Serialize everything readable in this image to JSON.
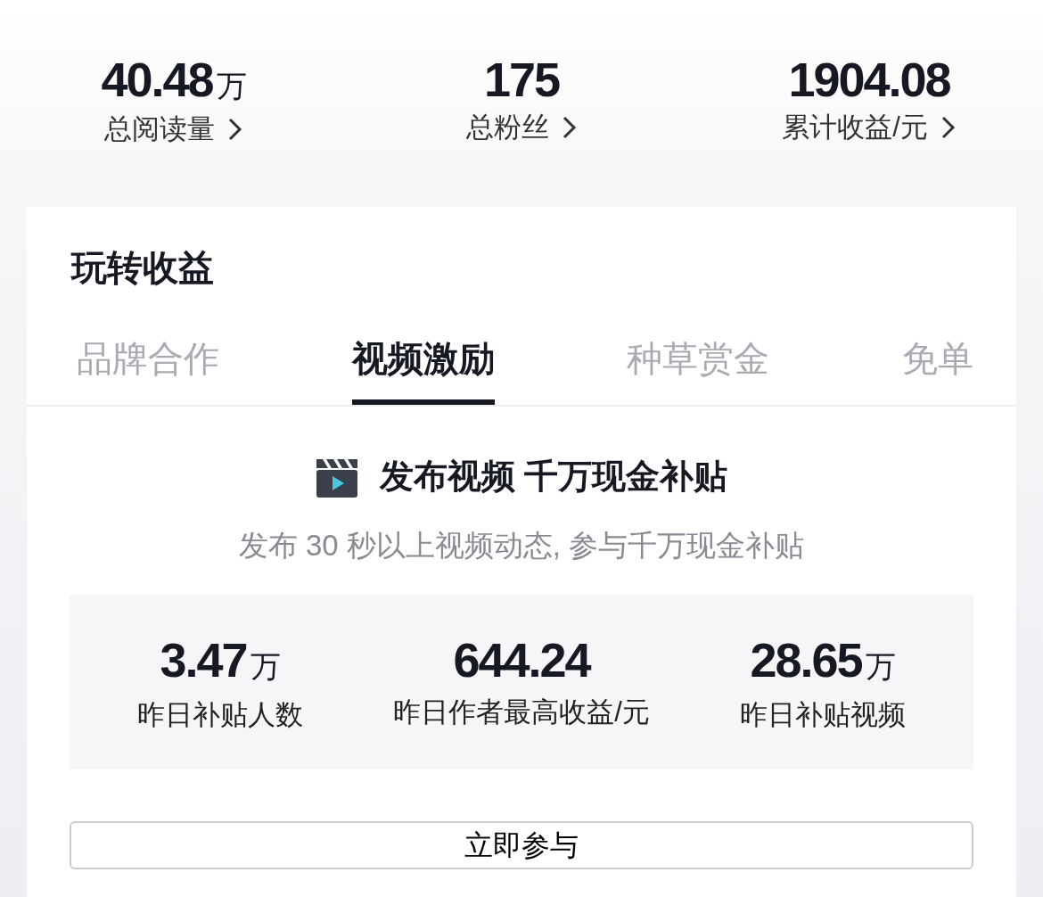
{
  "summary": [
    {
      "value": "40.48",
      "unit": "万",
      "label": "总阅读量"
    },
    {
      "value": "175",
      "label": "总粉丝"
    },
    {
      "value": "1904.08",
      "label": "累计收益/元"
    }
  ],
  "card": {
    "title": "玩转收益",
    "tabs": [
      {
        "label": "品牌合作",
        "selected": false
      },
      {
        "label": "视频激励",
        "selected": true
      },
      {
        "label": "种草赏金",
        "selected": false
      },
      {
        "label": "免单",
        "selected": false
      }
    ],
    "promo": {
      "title": "发布视频 千万现金补贴",
      "subtitle": "发布 30 秒以上视频动态, 参与千万现金补贴"
    },
    "stats": [
      {
        "value": "3.47",
        "unit": "万",
        "label": "昨日补贴人数"
      },
      {
        "value": "644.24",
        "label": "昨日作者最高收益/元"
      },
      {
        "value": "28.65",
        "unit": "万",
        "label": "昨日补贴视频"
      }
    ],
    "button": "立即参与"
  }
}
